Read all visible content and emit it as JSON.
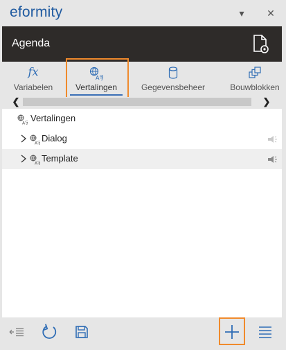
{
  "app": {
    "title": "eformity"
  },
  "window_controls": {
    "menu_glyph": "▾",
    "close_glyph": "✕"
  },
  "header": {
    "title": "Agenda",
    "action_icon": "document-settings-icon"
  },
  "tabs": [
    {
      "label": "Variabelen",
      "icon": "fx-icon",
      "active": false
    },
    {
      "label": "Vertalingen",
      "icon": "translate-icon",
      "active": true
    },
    {
      "label": "Gegevensbeheer",
      "icon": "database-icon",
      "active": false
    },
    {
      "label": "Bouwblokken",
      "icon": "building-blocks-icon",
      "active": false
    }
  ],
  "scroller": {
    "left_glyph": "❮",
    "right_glyph": "❯"
  },
  "tree": {
    "root": {
      "label": "Vertalingen",
      "icon": "translate-icon"
    },
    "children": [
      {
        "label": "Dialog",
        "icon": "translate-icon",
        "collapsed": true,
        "selected": false
      },
      {
        "label": "Template",
        "icon": "translate-icon",
        "collapsed": true,
        "selected": true
      }
    ]
  },
  "toolbar": {
    "left": [
      "outdent-icon",
      "refresh-icon",
      "save-icon"
    ],
    "right": [
      "add-icon",
      "menu-icon"
    ]
  },
  "colors": {
    "brand": "#1f5aa0",
    "header_bg": "#2e2b29",
    "accent_underline": "#3b6fb6",
    "highlight": "#f08a2c",
    "icon_blue": "#2f6db5"
  }
}
